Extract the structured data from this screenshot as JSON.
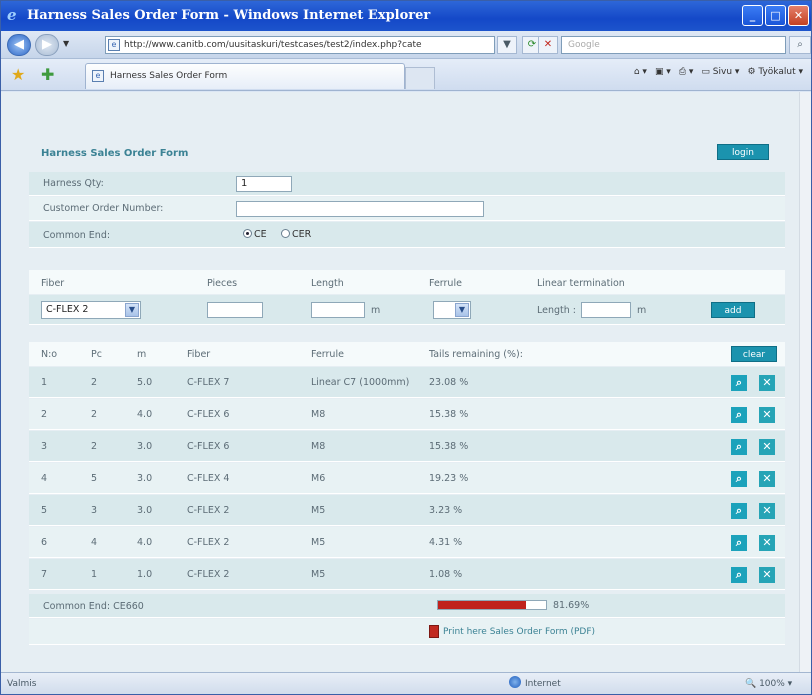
{
  "window": {
    "title": "Harness Sales Order Form - Windows Internet Explorer",
    "address": "http://www.canitb.com/uusitaskuri/testcases/test2/index.php?cate",
    "search_placeholder": "Google",
    "tab_label": "Harness Sales Order Form",
    "cmd_page": "Sivu",
    "cmd_tools": "Työkalut",
    "status_left": "Valmis",
    "status_zone": "Internet",
    "zoom": "100%"
  },
  "form": {
    "title": "Harness Sales Order Form",
    "login_label": "login",
    "harness_qty_label": "Harness Qty:",
    "harness_qty_value": "1",
    "customer_order_label": "Customer Order Number:",
    "customer_order_value": "",
    "common_end_label": "Common End:",
    "common_end_options": [
      "CE",
      "CER"
    ],
    "common_end_selected": "CE"
  },
  "entry": {
    "headers": {
      "fiber": "Fiber",
      "pieces": "Pieces",
      "length": "Length",
      "ferrule": "Ferrule",
      "linear_termination": "Linear termination"
    },
    "fiber_selected": "C-FLEX 2",
    "pieces_value": "",
    "length_value": "",
    "length_unit": "m",
    "ferrule_selected": "",
    "linear_length_label": "Length :",
    "linear_length_value": "",
    "linear_unit": "m",
    "add_label": "add"
  },
  "table": {
    "headers": {
      "no": "N:o",
      "pc": "Pc",
      "m": "m",
      "fiber": "Fiber",
      "ferrule": "Ferrule",
      "tails": "Tails remaining (%):"
    },
    "clear_label": "clear",
    "rows": [
      {
        "no": "1",
        "pc": "2",
        "m": "5.0",
        "fiber": "C-FLEX 7",
        "ferrule": "Linear C7 (1000mm)",
        "tails": "23.08 %"
      },
      {
        "no": "2",
        "pc": "2",
        "m": "4.0",
        "fiber": "C-FLEX 6",
        "ferrule": "M8",
        "tails": "15.38 %"
      },
      {
        "no": "3",
        "pc": "2",
        "m": "3.0",
        "fiber": "C-FLEX 6",
        "ferrule": "M8",
        "tails": "15.38 %"
      },
      {
        "no": "4",
        "pc": "5",
        "m": "3.0",
        "fiber": "C-FLEX 4",
        "ferrule": "M6",
        "tails": "19.23 %"
      },
      {
        "no": "5",
        "pc": "3",
        "m": "3.0",
        "fiber": "C-FLEX 2",
        "ferrule": "M5",
        "tails": "3.23 %"
      },
      {
        "no": "6",
        "pc": "4",
        "m": "4.0",
        "fiber": "C-FLEX 2",
        "ferrule": "M5",
        "tails": "4.31 %"
      },
      {
        "no": "7",
        "pc": "1",
        "m": "1.0",
        "fiber": "C-FLEX 2",
        "ferrule": "M5",
        "tails": "1.08 %"
      }
    ],
    "common_end_footer": "Common End: CE660",
    "total_percent_text": "81.69%",
    "total_fraction": 0.8169,
    "pdf_link": "Print here Sales Order Form (PDF)"
  },
  "colors": {
    "accent": "#1b93ae",
    "progress": "#c0221d",
    "title_text": "#3b8294"
  }
}
